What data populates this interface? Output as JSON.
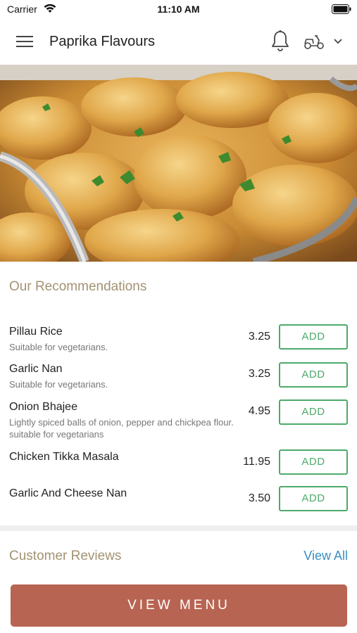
{
  "status_bar": {
    "carrier": "Carrier",
    "time": "11:10 AM"
  },
  "header": {
    "title": "Paprika Flavours"
  },
  "recommendations": {
    "title": "Our Recommendations",
    "items": [
      {
        "name": "Pillau Rice",
        "description": "Suitable for vegetarians.",
        "price": "3.25",
        "button": "ADD"
      },
      {
        "name": "Garlic Nan",
        "description": "Suitable for vegetarians.",
        "price": "3.25",
        "button": "ADD"
      },
      {
        "name": "Onion Bhajee",
        "description": "Lightly spiced balls of onion, pepper and chickpea flour. suitable for vegetarians",
        "price": "4.95",
        "button": "ADD"
      },
      {
        "name": "Chicken Tikka Masala",
        "description": "",
        "price": "11.95",
        "button": "ADD"
      },
      {
        "name": "Garlic And Cheese Nan",
        "description": "",
        "price": "3.50",
        "button": "ADD"
      }
    ]
  },
  "reviews": {
    "title": "Customer Reviews",
    "view_all": "View All"
  },
  "footer": {
    "view_menu": "VIEW MENU"
  },
  "colors": {
    "accent_green": "#4caa6a",
    "section_title": "#a39273",
    "link_blue": "#3b8fc2",
    "menu_button": "#b86452"
  }
}
